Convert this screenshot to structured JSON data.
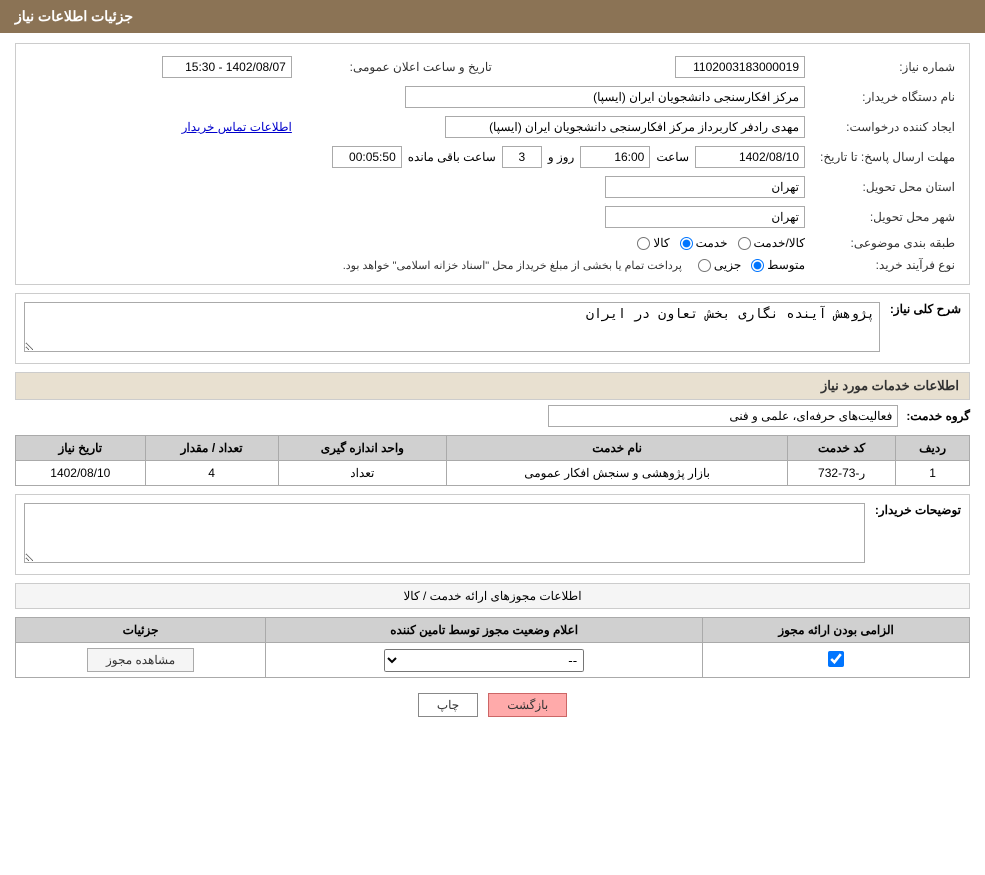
{
  "header": {
    "title": "جزئیات اطلاعات نیاز"
  },
  "need_info": {
    "need_number_label": "شماره نیاز:",
    "need_number_value": "1102003183000019",
    "announcement_date_label": "تاریخ و ساعت اعلان عمومی:",
    "announcement_date_value": "1402/08/07 - 15:30",
    "buyer_org_label": "نام دستگاه خریدار:",
    "buyer_org_value": "مرکز افکارسنجی دانشجویان ایران (ایسپا)",
    "requester_label": "ایجاد کننده درخواست:",
    "requester_value": "مهدی رادفر کاربرداز مرکز افکارسنجی دانشجویان ایران (ایسپا)",
    "contact_link": "اطلاعات تماس خریدار",
    "deadline_label": "مهلت ارسال پاسخ: تا تاریخ:",
    "deadline_date": "1402/08/10",
    "deadline_time_label": "ساعت",
    "deadline_time": "16:00",
    "deadline_days_label": "روز و",
    "deadline_days": "3",
    "deadline_remaining_label": "ساعت باقی مانده",
    "deadline_remaining": "00:05:50",
    "province_label": "استان محل تحویل:",
    "province_value": "تهران",
    "city_label": "شهر محل تحویل:",
    "city_value": "تهران",
    "category_label": "طبقه بندی موضوعی:",
    "category_options": [
      "کالا",
      "خدمت",
      "کالا/خدمت"
    ],
    "category_selected": "خدمت",
    "purchase_type_label": "نوع فرآیند خرید:",
    "purchase_type_options": [
      "جزیی",
      "متوسط"
    ],
    "purchase_type_selected": "متوسط",
    "purchase_note": "پرداخت تمام یا بخشی از مبلغ خریداز محل \"اسناد خزانه اسلامی\" خواهد بود."
  },
  "need_description": {
    "section_title": "شرح کلی نیاز:",
    "description_value": "پژوهش آینده نگاری بخش تعاون در ایران"
  },
  "services_section": {
    "section_title": "اطلاعات خدمات مورد نیاز",
    "service_group_label": "گروه خدمت:",
    "service_group_value": "فعالیت‌های حرفه‌ای، علمی و فنی",
    "table_headers": [
      "ردیف",
      "کد خدمت",
      "نام خدمت",
      "واحد اندازه گیری",
      "تعداد / مقدار",
      "تاریخ نیاز"
    ],
    "table_rows": [
      {
        "row": "1",
        "code": "ر-73-732",
        "name": "بازار پژوهشی و سنجش افکار عمومی",
        "unit": "تعداد",
        "quantity": "4",
        "date": "1402/08/10"
      }
    ]
  },
  "buyer_notes": {
    "section_title": "توضیحات خریدار:",
    "notes_value": ""
  },
  "licenses_section": {
    "section_title": "اطلاعات مجوزهای ارائه خدمت / کالا",
    "table_headers": [
      "الزامی بودن ارائه مجوز",
      "اعلام وضعیت مجوز توسط تامین کننده",
      "جزئیات"
    ],
    "table_rows": [
      {
        "required": true,
        "status": "--",
        "details_btn": "مشاهده مجوز"
      }
    ]
  },
  "buttons": {
    "print_label": "چاپ",
    "back_label": "بازگشت"
  }
}
